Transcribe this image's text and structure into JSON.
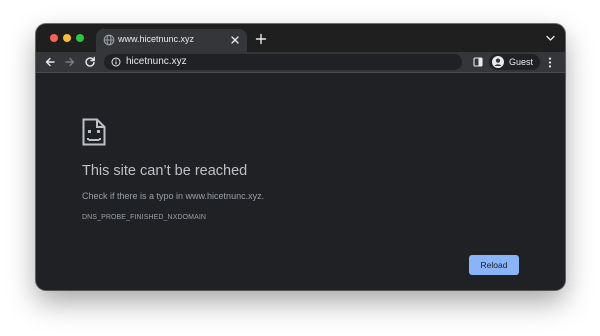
{
  "tab": {
    "title": "www.hicetnunc.xyz",
    "favicon": "globe-icon"
  },
  "toolbar": {
    "url": "hicetnunc.xyz",
    "profile_label": "Guest"
  },
  "error": {
    "title": "This site can’t be reached",
    "description": "Check if there is a typo in www.hicetnunc.xyz.",
    "code": "DNS_PROBE_FINISHED_NXDOMAIN",
    "reload_label": "Reload"
  },
  "colors": {
    "background": "#202124",
    "toolbar": "#35363a",
    "accent": "#8ab4f8",
    "title_text": "#bdc1c6",
    "secondary_text": "#9aa0a6"
  }
}
